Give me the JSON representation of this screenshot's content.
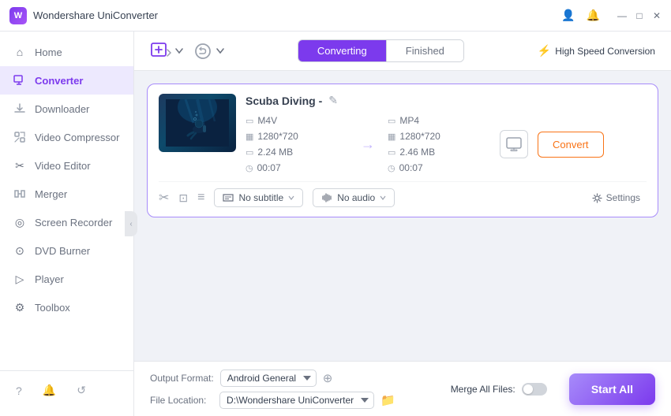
{
  "app": {
    "title": "Wondershare UniConverter",
    "icon_text": "W"
  },
  "titlebar": {
    "user_icon": "👤",
    "bell_icon": "🔔",
    "minimize_label": "—",
    "maximize_label": "□",
    "close_label": "✕"
  },
  "sidebar": {
    "items": [
      {
        "id": "home",
        "label": "Home",
        "icon": "⌂",
        "active": false
      },
      {
        "id": "converter",
        "label": "Converter",
        "icon": "⧉",
        "active": true
      },
      {
        "id": "downloader",
        "label": "Downloader",
        "icon": "⬇",
        "active": false
      },
      {
        "id": "video-compressor",
        "label": "Video Compressor",
        "icon": "⤓",
        "active": false
      },
      {
        "id": "video-editor",
        "label": "Video Editor",
        "icon": "✂",
        "active": false
      },
      {
        "id": "merger",
        "label": "Merger",
        "icon": "⊕",
        "active": false
      },
      {
        "id": "screen-recorder",
        "label": "Screen Recorder",
        "icon": "◎",
        "active": false
      },
      {
        "id": "dvd-burner",
        "label": "DVD Burner",
        "icon": "⊙",
        "active": false
      },
      {
        "id": "player",
        "label": "Player",
        "icon": "▷",
        "active": false
      },
      {
        "id": "toolbox",
        "label": "Toolbox",
        "icon": "⚙",
        "active": false
      }
    ],
    "bottom_items": [
      {
        "id": "help",
        "icon": "?",
        "label": "Help"
      },
      {
        "id": "notifications",
        "icon": "🔔",
        "label": "Notifications"
      },
      {
        "id": "feedback",
        "icon": "↺",
        "label": "Feedback"
      }
    ]
  },
  "content": {
    "header": {
      "add_file_icon": "+",
      "convert_select_icon": "⧖",
      "tabs": [
        {
          "id": "converting",
          "label": "Converting",
          "active": true
        },
        {
          "id": "finished",
          "label": "Finished",
          "active": false
        }
      ],
      "high_speed_label": "High Speed Conversion",
      "lightning_icon": "⚡"
    },
    "files": [
      {
        "id": "file-1",
        "name": "Scuba Diving -",
        "source_format": "M4V",
        "source_resolution": "1280*720",
        "source_size": "2.24 MB",
        "source_duration": "00:07",
        "dest_format": "MP4",
        "dest_resolution": "1280*720",
        "dest_size": "2.46 MB",
        "dest_duration": "00:07",
        "subtitle": "No subtitle",
        "audio": "No audio",
        "convert_label": "Convert"
      }
    ],
    "settings_label": "Settings"
  },
  "footer": {
    "output_format_label": "Output Format:",
    "output_format_value": "Android General",
    "merge_label": "Merge All Files:",
    "file_location_label": "File Location:",
    "file_location_value": "D:\\Wondershare UniConverter",
    "start_all_label": "Start All"
  }
}
